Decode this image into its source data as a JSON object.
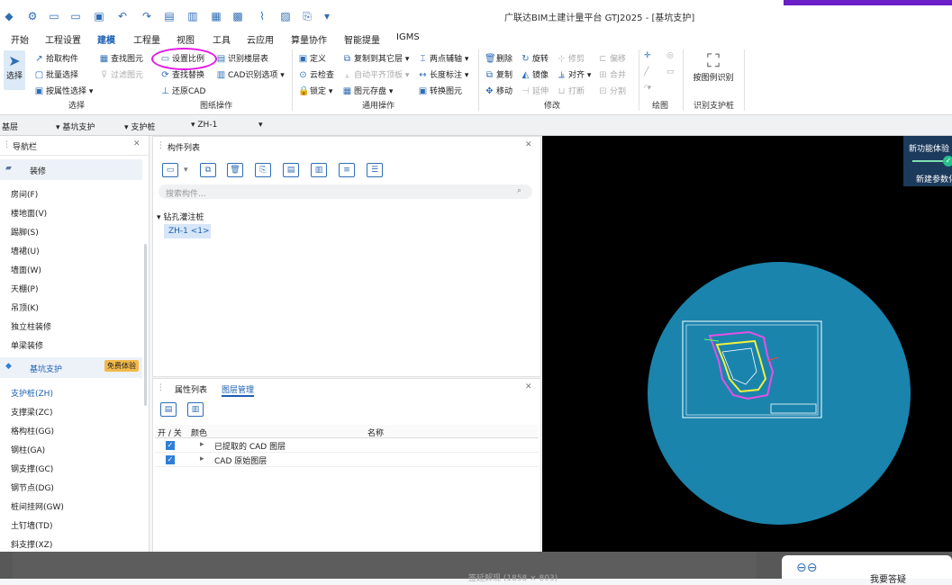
{
  "titlebar": {
    "title": "广联达BIM土建计量平台 GTJ2025 - [基坑支护]"
  },
  "menu": [
    "开始",
    "工程设置",
    "建模",
    "工程量",
    "视图",
    "工具",
    "云应用",
    "算量协作",
    "智能提量",
    "IGMS"
  ],
  "ribbon": {
    "select": {
      "label": "选择",
      "items": [
        "拾取构件",
        "批量选择",
        "按属性选择"
      ],
      "group": "选择"
    },
    "drawing": {
      "items": [
        "查找图元",
        "过滤图元",
        "设置比例",
        "查找替换",
        "还原CAD",
        "识别楼层表",
        "CAD识别选项"
      ],
      "group": "图纸操作"
    },
    "common": {
      "items": [
        "定义",
        "云检查",
        "锁定",
        "复制到其它层",
        "自动平齐顶板",
        "图元存盘",
        "两点辅轴",
        "长度标注",
        "转换图元"
      ],
      "group": "通用操作"
    },
    "modify": {
      "items": [
        "删除",
        "旋转",
        "修剪",
        "偏移",
        "复制",
        "镜像",
        "对齐",
        "合并",
        "移动",
        "延伸",
        "打断",
        "分割"
      ],
      "group": "修改"
    },
    "draw": {
      "group": "绘图"
    },
    "recognize": {
      "label": "按图例识别",
      "group": "识别支护桩"
    }
  },
  "filterbar": {
    "floor": "基层",
    "category": "基坑支护",
    "type": "支护桩",
    "item": "ZH-1"
  },
  "nav": {
    "title": "导航栏",
    "decor": {
      "label": "装修"
    },
    "decor_items": [
      "房间(F)",
      "楼地面(V)",
      "踢脚(S)",
      "墙裙(U)",
      "墙面(W)",
      "天棚(P)",
      "吊顶(K)",
      "独立柱装修",
      "单梁装修"
    ],
    "pit": {
      "label": "基坑支护",
      "badge": "免费体验"
    },
    "pit_items": [
      "支护桩(ZH)",
      "支撑梁(ZC)",
      "格构柱(GG)",
      "钢柱(GA)",
      "钢支撑(GC)",
      "钢节点(DG)",
      "桩间挂网(GW)",
      "土钉墙(TD)",
      "斜支撑(XZ)"
    ]
  },
  "complist": {
    "title": "构件列表",
    "search_placeholder": "搜索构件...",
    "tree_group": "钻孔灌注桩",
    "tree_item": "ZH-1 <1>"
  },
  "props": {
    "tabs": [
      "属性列表",
      "图层管理"
    ],
    "columns": [
      "开 / 关",
      "颜色",
      "名称"
    ],
    "rows": [
      {
        "checked": true,
        "name": "已提取的 CAD 图层"
      },
      {
        "checked": true,
        "name": "CAD 原始图层"
      }
    ]
  },
  "canvas": {
    "badge1": "新功能体验",
    "badge2": "新建参数化",
    "bg": "#000000",
    "circle": "#1a84ad"
  },
  "bottom": {
    "text": "签延解现 (1858 × 803)",
    "right": "我要答疑"
  }
}
